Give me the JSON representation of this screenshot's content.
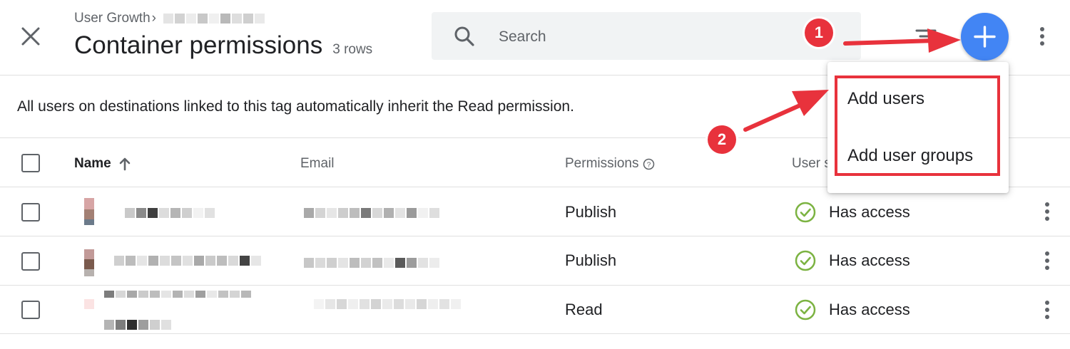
{
  "header": {
    "breadcrumb": "User Growth",
    "title": "Container permissions",
    "row_count": "3 rows",
    "close_icon": "close-icon"
  },
  "search": {
    "placeholder": "Search"
  },
  "info": {
    "text": "All users on destinations linked to this tag automatically inherit the Read permission."
  },
  "table": {
    "columns": [
      "Name",
      "Email",
      "Permissions",
      "User s"
    ],
    "rows": [
      {
        "permission": "Publish",
        "status": "Has access"
      },
      {
        "permission": "Publish",
        "status": "Has access"
      },
      {
        "permission": "Read",
        "status": "Has access"
      }
    ]
  },
  "menu": {
    "items": [
      "Add users",
      "Add user groups"
    ]
  },
  "annotations": {
    "badge1": "1",
    "badge2": "2"
  },
  "colors": {
    "accent": "#4285f4",
    "annotation": "#e8323c",
    "success": "#7cb342"
  }
}
